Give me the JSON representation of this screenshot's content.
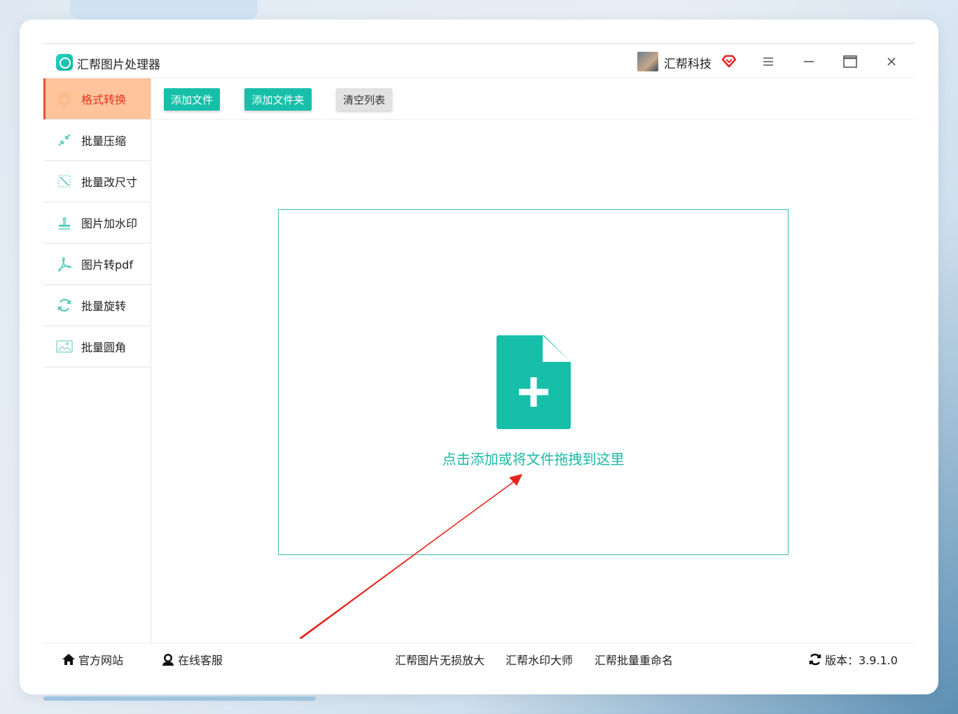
{
  "app": {
    "title": "汇帮图片处理器"
  },
  "user": {
    "name": "汇帮科技"
  },
  "sidebar": {
    "items": [
      {
        "label": "格式转换",
        "icon": "format-convert-icon",
        "active": true
      },
      {
        "label": "批量压缩",
        "icon": "compress-icon"
      },
      {
        "label": "批量改尺寸",
        "icon": "resize-icon"
      },
      {
        "label": "图片加水印",
        "icon": "watermark-icon"
      },
      {
        "label": "图片转pdf",
        "icon": "pdf-icon"
      },
      {
        "label": "批量旋转",
        "icon": "rotate-icon"
      },
      {
        "label": "批量圆角",
        "icon": "round-corner-icon"
      }
    ]
  },
  "toolbar": {
    "add_file": "添加文件",
    "add_folder": "添加文件夹",
    "clear_list": "清空列表"
  },
  "dropzone": {
    "text": "点击添加或将文件拖拽到这里"
  },
  "footer": {
    "official_site": "官方网站",
    "online_service": "在线客服",
    "link1": "汇帮图片无损放大",
    "link2": "汇帮水印大师",
    "link3": "汇帮批量重命名",
    "version": "版本：3.9.1.0"
  },
  "colors": {
    "accent": "#17bfa9",
    "active_bg": "#ffc49c",
    "active_text": "#e5361c",
    "arrow": "#e8231c"
  }
}
